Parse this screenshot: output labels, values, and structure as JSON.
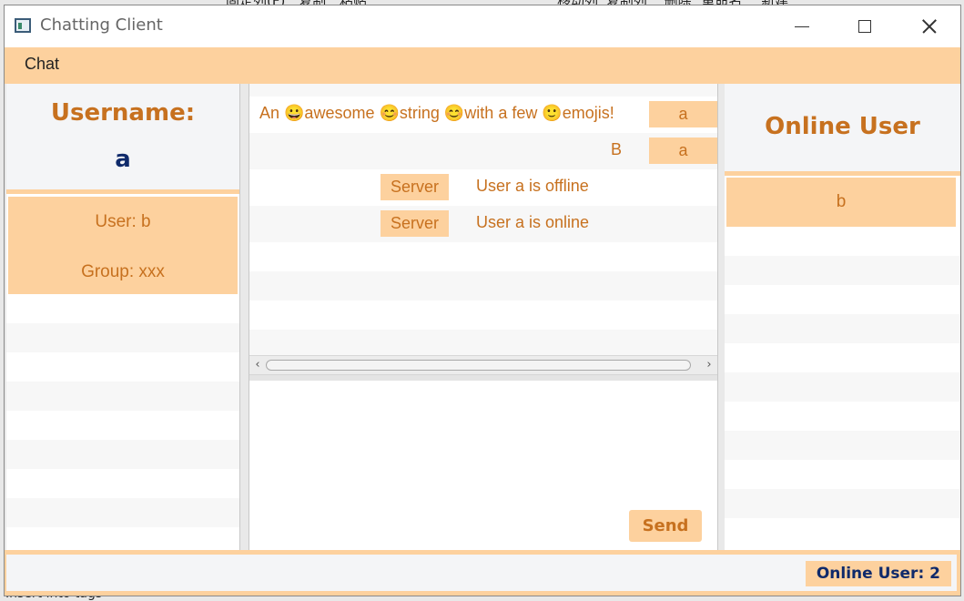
{
  "background": {
    "top_texts": [
      "固定列(F)",
      "复制",
      "粘贴",
      "移动列",
      "复制列",
      "删除",
      "重命名",
      "新建"
    ],
    "bottom_text": "Insert into tags"
  },
  "window": {
    "title": "Chatting Client",
    "icon": "window-app-icon"
  },
  "menu": {
    "items": [
      {
        "label": "Chat"
      }
    ]
  },
  "user_panel": {
    "username_label": "Username:",
    "username_value": "a"
  },
  "contacts": [
    {
      "user": "User: b",
      "group": "Group: xxx"
    }
  ],
  "messages": [
    {
      "text": "An 😀awesome 😊string 😊with a few 🙂emojis!",
      "sender": "a",
      "align": "right"
    },
    {
      "text": "B",
      "sender": "a",
      "align": "right"
    },
    {
      "sender": "Server",
      "text": "User a is offline",
      "align": "center"
    },
    {
      "sender": "Server",
      "text": "User a is online",
      "align": "center"
    }
  ],
  "composer": {
    "send_label": "Send"
  },
  "online_panel": {
    "title": "Online User",
    "users": [
      "b"
    ]
  },
  "status_bar": {
    "online_count": "Online User: 2"
  },
  "colors": {
    "accent": "#fdd19e",
    "accent_text": "#c7711f",
    "header_bg": "#f4f5f7",
    "dark_text": "#0f2a6b"
  }
}
